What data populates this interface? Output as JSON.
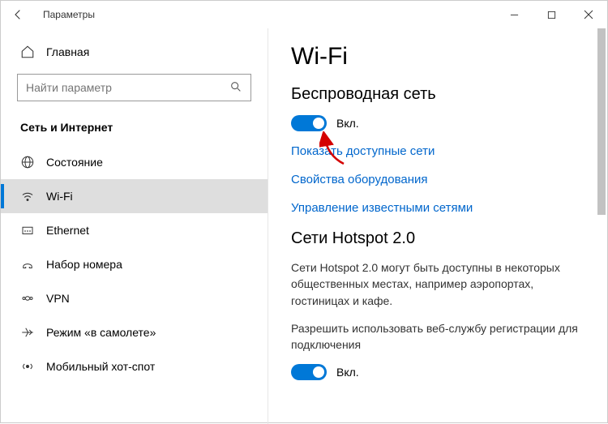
{
  "window": {
    "title": "Параметры"
  },
  "sidebar": {
    "home_label": "Главная",
    "search_placeholder": "Найти параметр",
    "category": "Сеть и Интернет",
    "items": [
      {
        "label": "Состояние"
      },
      {
        "label": "Wi-Fi"
      },
      {
        "label": "Ethernet"
      },
      {
        "label": "Набор номера"
      },
      {
        "label": "VPN"
      },
      {
        "label": "Режим «в самолете»"
      },
      {
        "label": "Мобильный хот-спот"
      }
    ]
  },
  "content": {
    "page_title": "Wi-Fi",
    "wireless": {
      "heading": "Беспроводная сеть",
      "toggle_label": "Вкл.",
      "links": [
        "Показать доступные сети",
        "Свойства оборудования",
        "Управление известными сетями"
      ]
    },
    "hotspot": {
      "heading": "Сети Hotspot 2.0",
      "description": "Сети Hotspot 2.0 могут быть доступны в некоторых общественных местах, например аэропортах, гостиницах и кафе.",
      "allow_text": "Разрешить использовать веб-службу регистрации для подключения",
      "toggle_label": "Вкл."
    }
  }
}
